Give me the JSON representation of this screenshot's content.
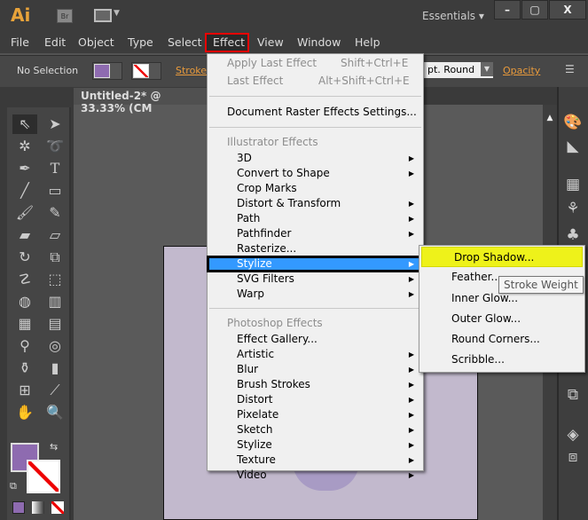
{
  "app": {
    "logo": "Ai",
    "bridge": "Br",
    "workspace": "Essentials",
    "window_buttons": [
      "–",
      "▢",
      "X"
    ]
  },
  "menubar": [
    "File",
    "Edit",
    "Object",
    "Type",
    "Select",
    "Effect",
    "View",
    "Window",
    "Help"
  ],
  "control": {
    "selection": "No Selection",
    "stroke_label": "Stroke:",
    "brush": "pt. Round",
    "opacity": "Opacity",
    "fill_color": "#8e6bb0"
  },
  "document": {
    "tab": "Untitled-2* @ 33.33% (CM"
  },
  "effect_menu": {
    "apply_last": {
      "label": "Apply Last Effect",
      "shortcut": "Shift+Ctrl+E"
    },
    "last": {
      "label": "Last Effect",
      "shortcut": "Alt+Shift+Ctrl+E"
    },
    "raster_settings": "Document Raster Effects Settings...",
    "illustrator_header": "Illustrator Effects",
    "illustrator": [
      {
        "label": "3D",
        "sub": true
      },
      {
        "label": "Convert to Shape",
        "sub": true
      },
      {
        "label": "Crop Marks",
        "sub": false
      },
      {
        "label": "Distort & Transform",
        "sub": true
      },
      {
        "label": "Path",
        "sub": true
      },
      {
        "label": "Pathfinder",
        "sub": true
      },
      {
        "label": "Rasterize...",
        "sub": false
      },
      {
        "label": "Stylize",
        "sub": true
      },
      {
        "label": "SVG Filters",
        "sub": true
      },
      {
        "label": "Warp",
        "sub": true
      }
    ],
    "photoshop_header": "Photoshop Effects",
    "photoshop": [
      {
        "label": "Effect Gallery...",
        "sub": false
      },
      {
        "label": "Artistic",
        "sub": true
      },
      {
        "label": "Blur",
        "sub": true
      },
      {
        "label": "Brush Strokes",
        "sub": true
      },
      {
        "label": "Distort",
        "sub": true
      },
      {
        "label": "Pixelate",
        "sub": true
      },
      {
        "label": "Sketch",
        "sub": true
      },
      {
        "label": "Stylize",
        "sub": true
      },
      {
        "label": "Texture",
        "sub": true
      },
      {
        "label": "Video",
        "sub": true
      }
    ]
  },
  "stylize_submenu": [
    "Drop Shadow...",
    "Feather...",
    "Inner Glow...",
    "Outer Glow...",
    "Round Corners...",
    "Scribble..."
  ],
  "tooltip": "Stroke Weight"
}
